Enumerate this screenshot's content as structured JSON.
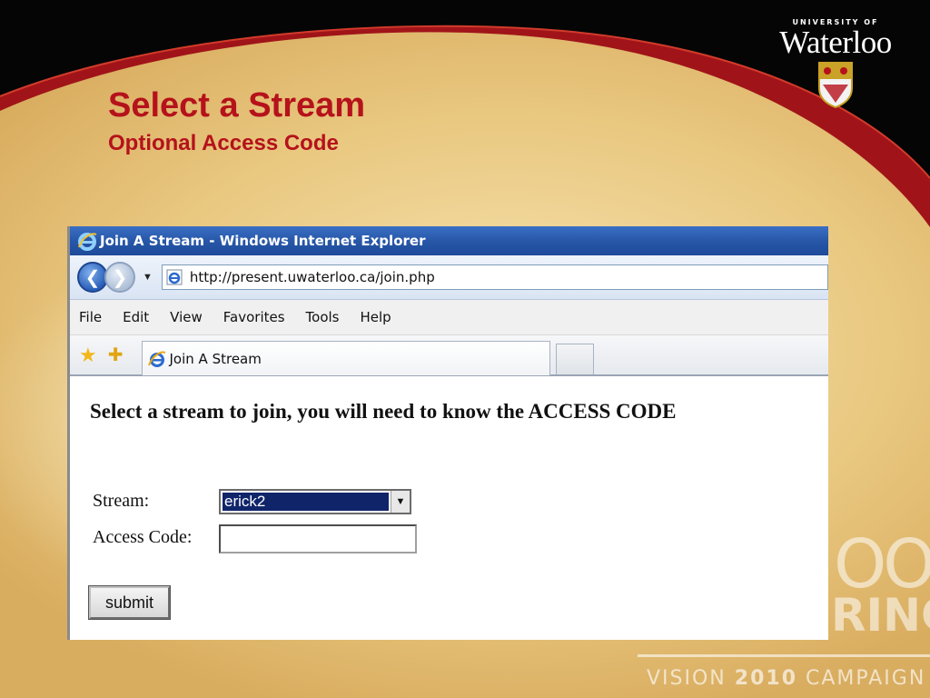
{
  "slide": {
    "title": "Select a Stream",
    "subtitle": "Optional Access Code",
    "logo": {
      "small_text": "UNIVERSITY OF",
      "big_text": "Waterloo"
    },
    "watermark": {
      "oo": "OO",
      "ring": "RING",
      "campaign_prefix": "VISION",
      "campaign_year": "2010",
      "campaign_suffix": "CAMPAIGN"
    },
    "colors": {
      "title_red": "#b5121b",
      "band_red": "#a01419",
      "band_black": "#050505"
    }
  },
  "browser": {
    "window_title": "Join A Stream - Windows Internet Explorer",
    "url": "http://present.uwaterloo.ca/join.php",
    "menu": [
      "File",
      "Edit",
      "View",
      "Favorites",
      "Tools",
      "Help"
    ],
    "tab_title": "Join A Stream",
    "icons": {
      "back": "back-arrow-icon",
      "forward": "forward-arrow-icon",
      "favorites": "star-icon",
      "add_favorite": "add-favorite-icon",
      "ie": "internet-explorer-icon"
    }
  },
  "page": {
    "heading": "Select a stream to join, you will need to know the ACCESS CODE",
    "stream_label": "Stream:",
    "stream_value": "erick2",
    "access_label": "Access Code:",
    "access_value": "",
    "submit_label": "submit"
  }
}
